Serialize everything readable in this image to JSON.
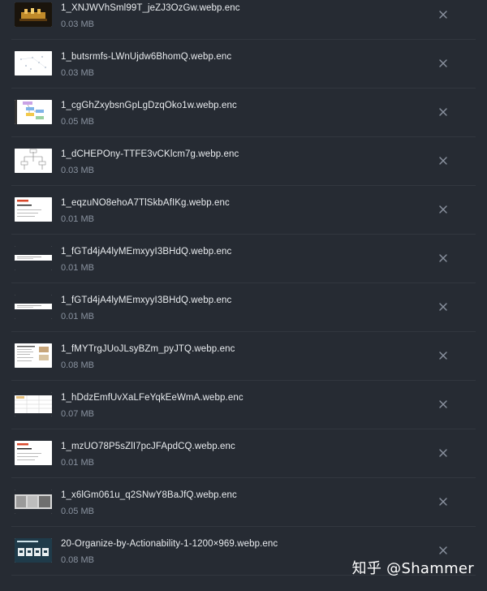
{
  "files": [
    {
      "name": "1_XNJWVhSml99T_jeZJ3OzGw.webp.enc",
      "size": "0.03 MB",
      "thumb": "dark-photo"
    },
    {
      "name": "1_butsrmfs-LWnUjdw6BhomQ.webp.enc",
      "size": "0.03 MB",
      "thumb": "white-scatter"
    },
    {
      "name": "1_cgGhZxybsnGpLgDzqOko1w.webp.enc",
      "size": "0.05 MB",
      "thumb": "flow-diagram"
    },
    {
      "name": "1_dCHEPOny-TTFE3vCKlcm7g.webp.enc",
      "size": "0.03 MB",
      "thumb": "tree-diagram"
    },
    {
      "name": "1_eqzuNO8ehoA7TlSkbAfIKg.webp.enc",
      "size": "0.01 MB",
      "thumb": "slide-red"
    },
    {
      "name": "1_fGTd4jA4lyMEmxyyI3BHdQ.webp.enc",
      "size": "0.01 MB",
      "thumb": "thin-strip"
    },
    {
      "name": "1_fGTd4jA4lyMEmxyyI3BHdQ.webp.enc",
      "size": "0.01 MB",
      "thumb": "thin-strip"
    },
    {
      "name": "1_fMYTrgJUoJLsyBZm_pyJTQ.webp.enc",
      "size": "0.08 MB",
      "thumb": "document"
    },
    {
      "name": "1_hDdzEmfUvXaLFeYqkEeWmA.webp.enc",
      "size": "0.07 MB",
      "thumb": "table"
    },
    {
      "name": "1_mzUO78P5sZlI7pcJFApdCQ.webp.enc",
      "size": "0.01 MB",
      "thumb": "slide-red"
    },
    {
      "name": "1_x6lGm061u_q2SNwY8BaJfQ.webp.enc",
      "size": "0.05 MB",
      "thumb": "photo-strip"
    },
    {
      "name": "20-Organize-by-Actionability-1-1200×969.webp.enc",
      "size": "0.08 MB",
      "thumb": "dark-slide"
    }
  ],
  "remove_icon": "close-icon",
  "watermark": "知乎 @Shammer",
  "colors": {
    "background": "#262b33",
    "filename": "#e9ecef",
    "filesize": "#8a93a0",
    "remove": "#8b93a0"
  }
}
